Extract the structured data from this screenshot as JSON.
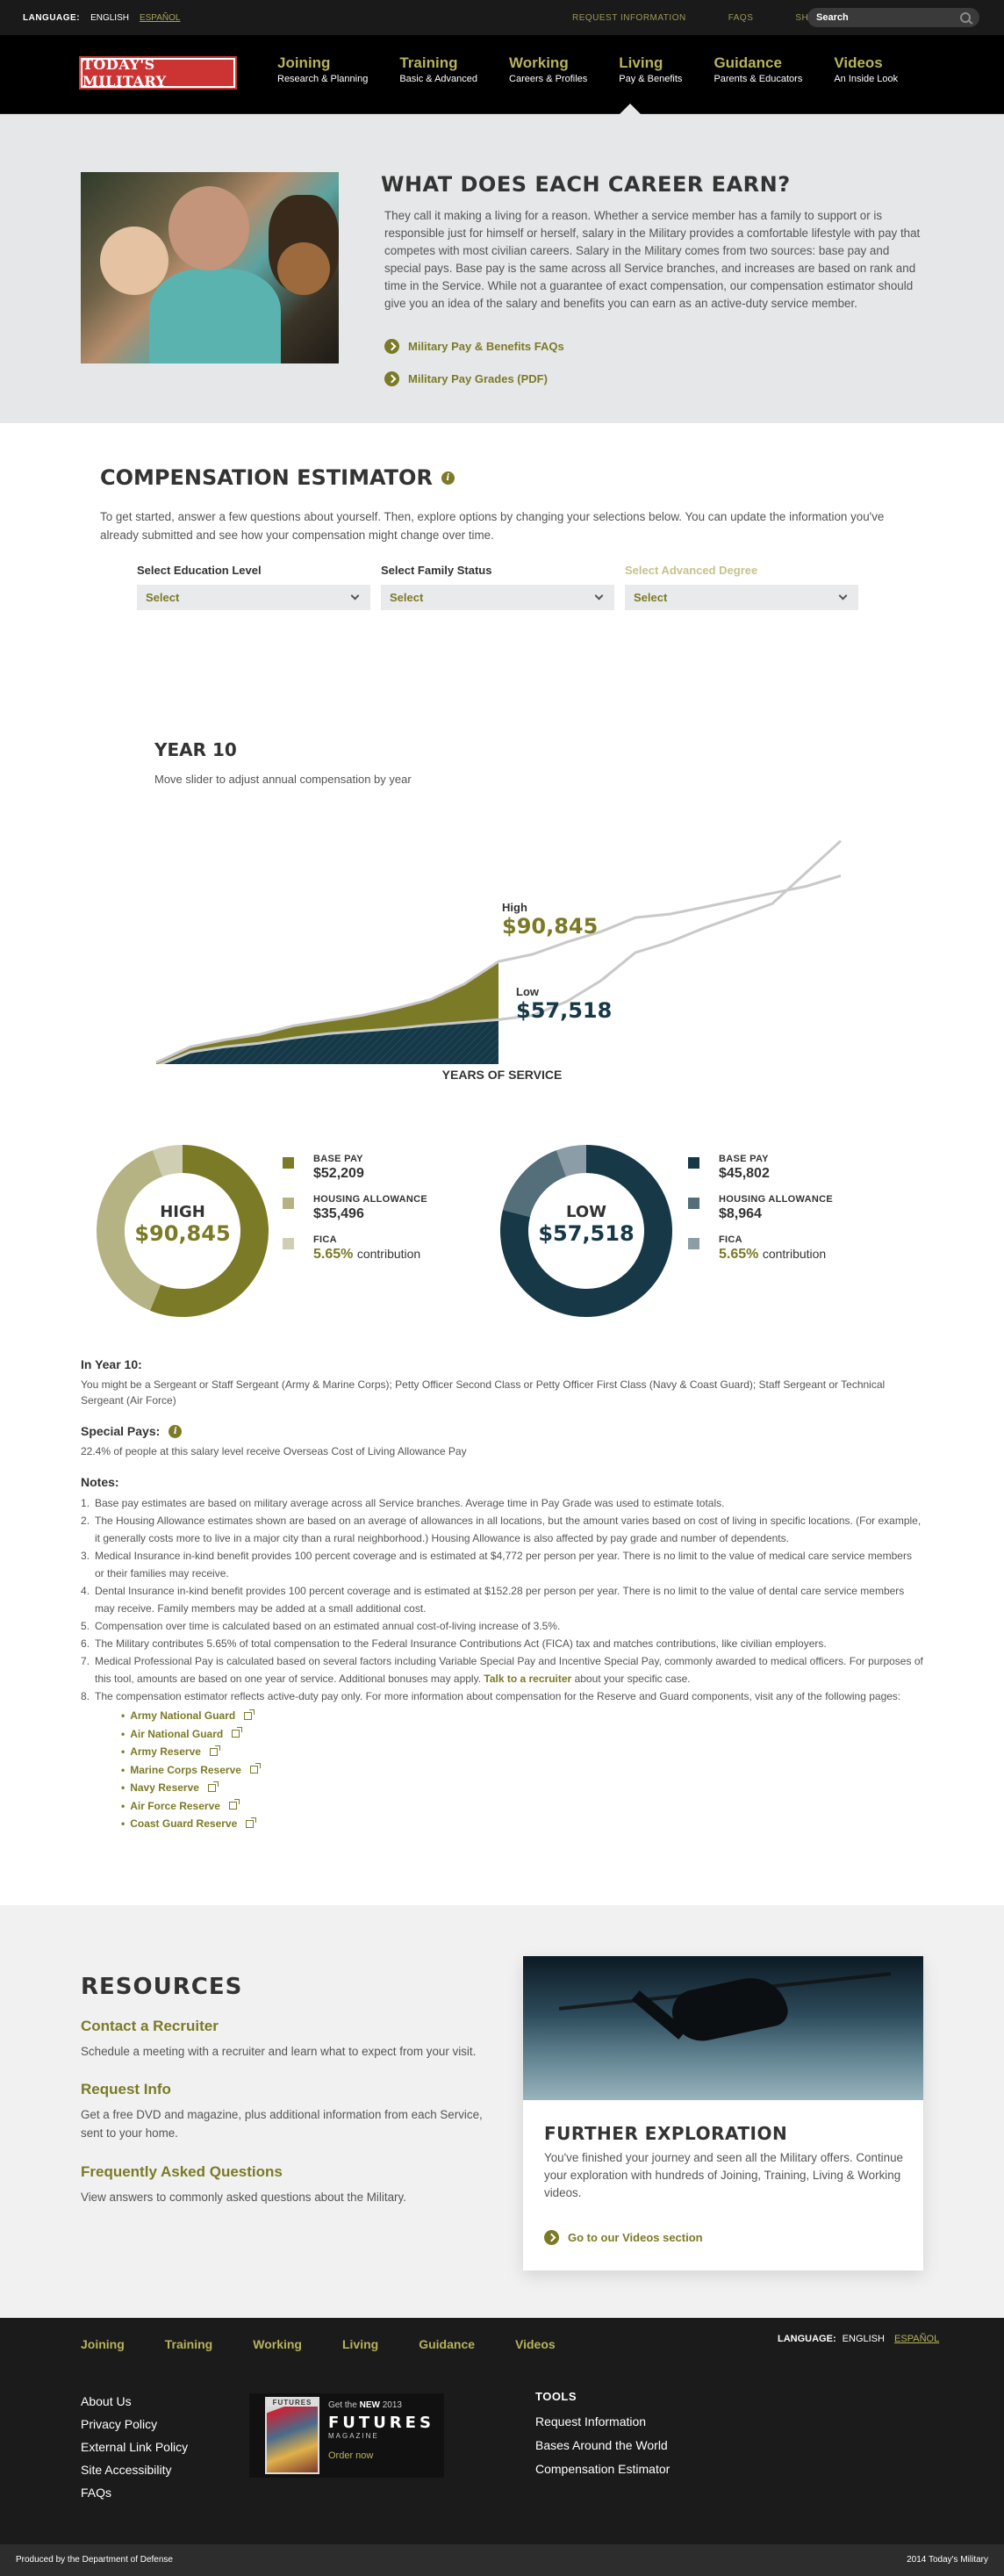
{
  "topbar": {
    "language_label": "LANGUAGE:",
    "lang_english": "ENGLISH",
    "lang_spanish": "ESPAÑOL",
    "links": [
      "REQUEST INFORMATION",
      "FAQS",
      "SHARE"
    ],
    "search_placeholder": "Search"
  },
  "header": {
    "logo_text": "TODAY'S MILITARY",
    "nav": [
      {
        "title": "Joining",
        "sub": "Research & Planning"
      },
      {
        "title": "Training",
        "sub": "Basic & Advanced"
      },
      {
        "title": "Working",
        "sub": "Careers & Profiles"
      },
      {
        "title": "Living",
        "sub": "Pay & Benefits"
      },
      {
        "title": "Guidance",
        "sub": "Parents & Educators"
      },
      {
        "title": "Videos",
        "sub": "An Inside Look"
      }
    ],
    "active_nav": "Living"
  },
  "intro": {
    "title": "WHAT DOES EACH CAREER EARN?",
    "body": "They call it making a living for a reason. Whether a service member has a family to support or is responsible just for himself or herself, salary in the Military provides a comfortable lifestyle with pay that competes with most civilian careers. Salary in the Military comes from two sources: base pay and special pays. Base pay is the same across all Service branches, and increases are based on rank and time in the Service. While not a guarantee of exact compensation, our compensation estimator should give you an idea of the salary and benefits you can earn as an active-duty service member.",
    "link1": "Military Pay & Benefits FAQs",
    "link2": "Military Pay Grades (PDF)"
  },
  "estimator": {
    "title": "COMPENSATION ESTIMATOR",
    "description": "To get started, answer a few questions about yourself. Then, explore options by changing your selections below. You can update the information you've already submitted and see how your compensation might change over time.",
    "selects": [
      {
        "label": "Select Education Level",
        "value": "Select",
        "disabled": false
      },
      {
        "label": "Select Family Status",
        "value": "Select",
        "disabled": false
      },
      {
        "label": "Select Advanced Degree",
        "value": "Select",
        "disabled": true
      }
    ],
    "year_title": "YEAR 10",
    "year_subtitle": "Move slider to adjust annual compensation by year",
    "high_label": "High",
    "high_value": "$90,845",
    "low_label": "Low",
    "low_value": "$57,518",
    "slider_selected": "10",
    "slider_label": "YEARS OF SERVICE"
  },
  "chart_data": [
    {
      "type": "area",
      "x": [
        0,
        1,
        2,
        3,
        4,
        5,
        6,
        7,
        8,
        9,
        10,
        11,
        12,
        13,
        14,
        15,
        16,
        17,
        18,
        19,
        20
      ],
      "x_ticks": [
        "0",
        "2",
        "4",
        "6",
        "8",
        "10",
        "12",
        "14",
        "16",
        "18",
        "20"
      ],
      "xlabel": "YEARS OF SERVICE",
      "selected_year": 10,
      "series": [
        {
          "name": "High",
          "values": [
            33000,
            42000,
            46000,
            49000,
            54000,
            57000,
            60000,
            64000,
            69000,
            78000,
            90845,
            95000,
            102000,
            108000,
            116000,
            118000,
            122000,
            126000,
            130000,
            134000,
            140000
          ]
        },
        {
          "name": "Low",
          "values": [
            31000,
            39000,
            42000,
            44000,
            47000,
            49500,
            51000,
            52500,
            54500,
            56000,
            57518,
            60000,
            68000,
            80000,
            96000,
            102000,
            110000,
            117000,
            124000,
            142000,
            160000
          ]
        }
      ]
    },
    {
      "type": "pie",
      "center_label": "HIGH",
      "center_value": "$90,845",
      "slices": [
        {
          "name": "BASE PAY",
          "display": "$52,209",
          "value": 52209,
          "color": "#7b7a26"
        },
        {
          "name": "HOUSING ALLOWANCE",
          "display": "$35,496",
          "value": 35496,
          "color": "#b5b384"
        },
        {
          "name": "FICA",
          "display": "5.65%",
          "value": 5.65,
          "color": "#cfcdb2",
          "suffix": "contribution"
        }
      ]
    },
    {
      "type": "pie",
      "center_label": "LOW",
      "center_value": "$57,518",
      "slices": [
        {
          "name": "BASE PAY",
          "display": "$45,802",
          "value": 45802,
          "color": "#163847"
        },
        {
          "name": "HOUSING ALLOWANCE",
          "display": "$8,964",
          "value": 8964,
          "color": "#546e7a"
        },
        {
          "name": "FICA",
          "display": "5.65%",
          "value": 5.65,
          "color": "#8b9ea7",
          "suffix": "contribution"
        }
      ]
    }
  ],
  "details": {
    "year_heading": "In Year 10:",
    "year_text": "You might be a Sergeant or Staff Sergeant (Army & Marine Corps); Petty Officer Second Class or Petty Officer First Class (Navy & Coast Guard); Staff Sergeant or Technical Sergeant (Air Force)",
    "special_heading": "Special Pays:",
    "special_text": "22.4% of people at this salary level receive Overseas Cost of Living Allowance Pay",
    "notes_heading": "Notes:",
    "notes": [
      "Base pay estimates are based on military average across all Service branches. Average time in Pay Grade was used to estimate totals.",
      "The Housing Allowance estimates shown are based on an average of allowances in all locations, but the amount varies based on cost of living in specific locations. (For example, it generally costs more to live in a major city than a rural neighborhood.) Housing Allowance is also affected by pay grade and number of dependents.",
      "Medical Insurance in-kind benefit provides 100 percent coverage and is estimated at $4,772 per person per year. There is no limit to the value of medical care service members or their families may receive.",
      "Dental Insurance in-kind benefit provides 100 percent coverage and is estimated at $152.28 per person per year. There is no limit to the value of dental care service members may receive. Family members may be added at a small additional cost.",
      "Compensation over time is calculated based on an estimated annual cost-of-living increase of 3.5%.",
      "The Military contributes 5.65% of total compensation to the Federal Insurance Contributions Act (FICA) tax and matches contributions, like civilian employers."
    ],
    "note7_pre": "Medical Professional Pay is calculated based on several factors including Variable Special Pay and Incentive Special Pay, commonly awarded to medical officers. For purposes of this tool, amounts are based on one year of service. Additional bonuses may apply.",
    "note7_link": "Talk to a recruiter",
    "note7_post": "about your specific case.",
    "note8": "The compensation estimator reflects active-duty pay only. For more information about compensation for the Reserve and Guard components, visit any of the following pages:",
    "reserve_links": [
      "Army National Guard",
      "Air National Guard",
      "Army Reserve",
      "Marine Corps Reserve",
      "Navy Reserve",
      "Air Force Reserve",
      "Coast Guard Reserve"
    ]
  },
  "resources": {
    "title": "RESOURCES",
    "items": [
      {
        "title": "Contact a Recruiter",
        "desc": "Schedule a meeting with a recruiter and learn what to expect from your visit."
      },
      {
        "title": "Request Info",
        "desc": "Get a free DVD and magazine, plus additional information from each Service, sent to your home."
      },
      {
        "title": "Frequently Asked Questions",
        "desc": "View answers to commonly asked questions about the Military."
      }
    ],
    "explore_title": "FURTHER EXPLORATION",
    "explore_body": "You've finished your journey and seen all the Military offers. Continue your exploration with hundreds of Joining, Training, Living & Working videos.",
    "explore_link": "Go to our Videos section"
  },
  "footer": {
    "nav": [
      "Joining",
      "Training",
      "Working",
      "Living",
      "Guidance",
      "Videos"
    ],
    "language_label": "LANGUAGE:",
    "lang_english": "ENGLISH",
    "lang_spanish": "ESPAÑOL",
    "links": [
      "About Us",
      "Privacy Policy",
      "External Link Policy",
      "Site Accessibility",
      "FAQs"
    ],
    "futures_cover": "FUTURES",
    "futures_small_pre": "Get the",
    "futures_small_new": "NEW",
    "futures_small_post": "2013",
    "futures_title": "FUTURES",
    "futures_mag": "MAGAZINE",
    "futures_order": "Order now",
    "tools_title": "TOOLS",
    "tools": [
      "Request Information",
      "Bases Around the World",
      "Compensation Estimator"
    ],
    "produced": "Produced by the Department of Defense",
    "copyright": "2014 Today's Military"
  }
}
